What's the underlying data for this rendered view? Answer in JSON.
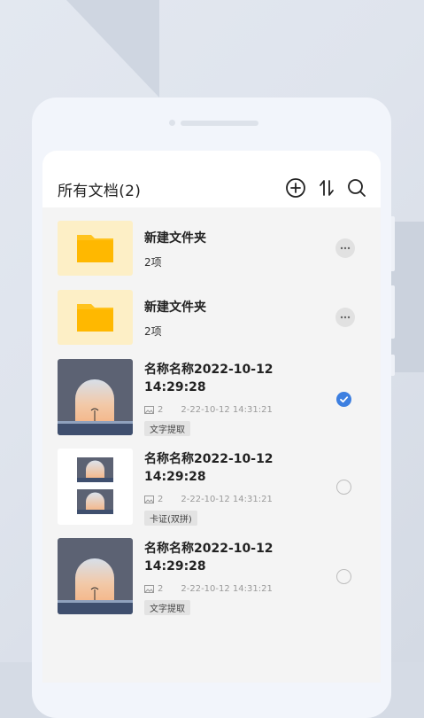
{
  "header": {
    "title": "所有文档(2)",
    "icons": [
      "add-circle-icon",
      "sort-icon",
      "search-icon"
    ]
  },
  "folders": [
    {
      "name": "新建文件夹",
      "count": "2项",
      "icon": "folder-icon"
    },
    {
      "name": "新建文件夹",
      "count": "2项",
      "icon": "folder-icon"
    }
  ],
  "documents": [
    {
      "name_line1": "名称名称2022-10-12",
      "name_line2": "14:29:28",
      "pages": "2",
      "date": "2-22-10-12  14:31:21",
      "tag": "文字提取",
      "selected": true
    },
    {
      "name_line1": "名称名称2022-10-12",
      "name_line2": "14:29:28",
      "pages": "2",
      "date": "2-22-10-12  14:31:21",
      "tag": "卡证(双拼)",
      "selected": false
    },
    {
      "name_line1": "名称名称2022-10-12",
      "name_line2": "14:29:28",
      "pages": "2",
      "date": "2-22-10-12  14:31:21",
      "tag": "文字提取",
      "selected": false
    }
  ],
  "colors": {
    "accent": "#3d7fe0",
    "folder": "#ffc31e",
    "folder_bg": "#fdefc6"
  }
}
